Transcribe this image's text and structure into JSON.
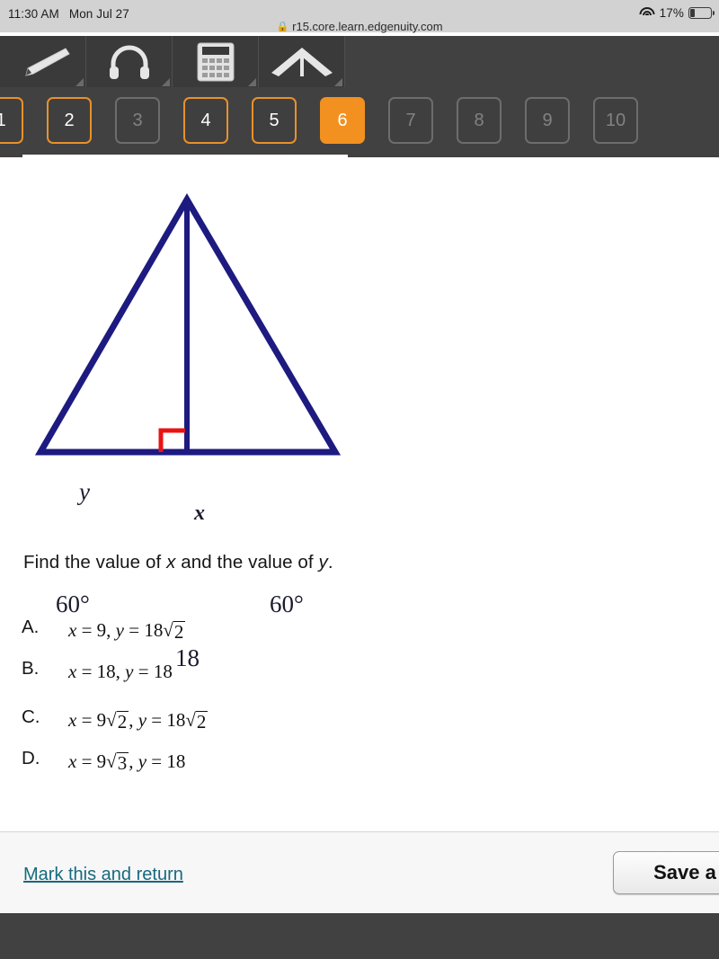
{
  "status_bar": {
    "time": "11:30 AM",
    "date": "Mon Jul 27",
    "battery_percent": "17%",
    "wifi_icon": "wifi-icon",
    "battery_icon": "battery-icon"
  },
  "browser": {
    "lock_icon": "lock-icon",
    "url": "r15.core.learn.edgenuity.com"
  },
  "toolbar": {
    "tools": [
      {
        "name": "highlighter-tool",
        "icon": "pencil-icon"
      },
      {
        "name": "audio-tool",
        "icon": "headphones-icon"
      },
      {
        "name": "calculator-tool",
        "icon": "calculator-icon"
      },
      {
        "name": "protractor-tool",
        "icon": "compass-icon"
      }
    ]
  },
  "question_nav": {
    "items": [
      {
        "label": "1",
        "state": "answered"
      },
      {
        "label": "2",
        "state": "answered"
      },
      {
        "label": "3",
        "state": "disabled"
      },
      {
        "label": "4",
        "state": "answered"
      },
      {
        "label": "5",
        "state": "answered"
      },
      {
        "label": "6",
        "state": "current"
      },
      {
        "label": "7",
        "state": "disabled"
      },
      {
        "label": "8",
        "state": "disabled"
      },
      {
        "label": "9",
        "state": "disabled"
      },
      {
        "label": "10",
        "state": "disabled"
      }
    ]
  },
  "figure": {
    "name": "triangle-diagram",
    "line_color": "#1d1a80",
    "right_angle_color": "#e81414",
    "label_side_y": "y",
    "label_altitude_x": "x",
    "label_angle_left": "60°",
    "label_angle_right": "60°",
    "label_base": "18"
  },
  "question": {
    "prompt_part1": "Find the value of ",
    "prompt_var1": "x",
    "prompt_part2": " and the value of ",
    "prompt_var2": "y",
    "prompt_part3": "."
  },
  "choices": [
    {
      "letter": "A.",
      "text": "x = 9, y = 18√2"
    },
    {
      "letter": "B.",
      "text": "x = 18, y = 18"
    },
    {
      "letter": "C.",
      "text": "x = 9√2, y = 18√2"
    },
    {
      "letter": "D.",
      "text": "x = 9√3, y = 18"
    }
  ],
  "footer": {
    "mark_link": "Mark this and return",
    "save_button": "Save a"
  },
  "colors": {
    "accent_orange": "#f2911f",
    "accent_orange_border": "#e8912a",
    "chrome_dark": "#414141",
    "link_teal": "#16697e"
  }
}
